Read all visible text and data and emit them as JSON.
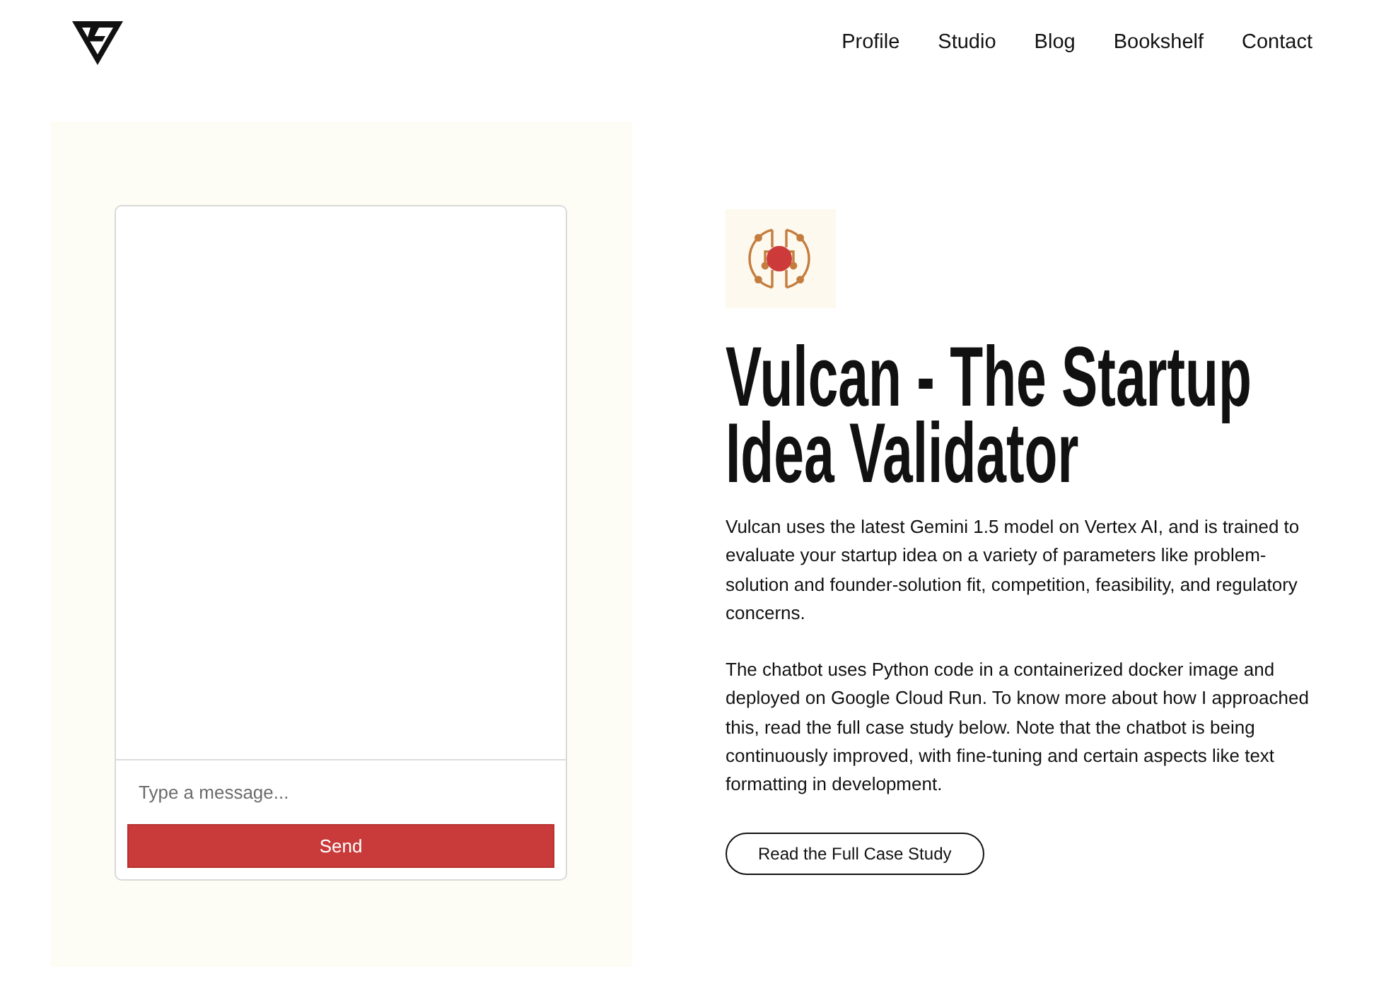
{
  "header": {
    "nav": [
      {
        "label": "Profile"
      },
      {
        "label": "Studio"
      },
      {
        "label": "Blog"
      },
      {
        "label": "Bookshelf"
      },
      {
        "label": "Contact"
      }
    ]
  },
  "chat_widget": {
    "input": {
      "placeholder": "Type a message..."
    },
    "send_button": "Send"
  },
  "project": {
    "title": "Vulcan - The Startup Idea Validator",
    "paragraphs": [
      "Vulcan uses the latest Gemini 1.5 model on Vertex AI, and is trained to evaluate your startup idea on a variety of parameters like problem-solution and founder-solution fit, competition, feasibility, and regulatory concerns.",
      "The chatbot uses Python code in a containerized docker image and deployed on Google Cloud Run. To know more about how I approached this, read the full case study below. Note that the chatbot is being continuously improved, with fine-tuning and certain aspects like text formatting in development."
    ],
    "button": "Read the Full Case Study"
  }
}
